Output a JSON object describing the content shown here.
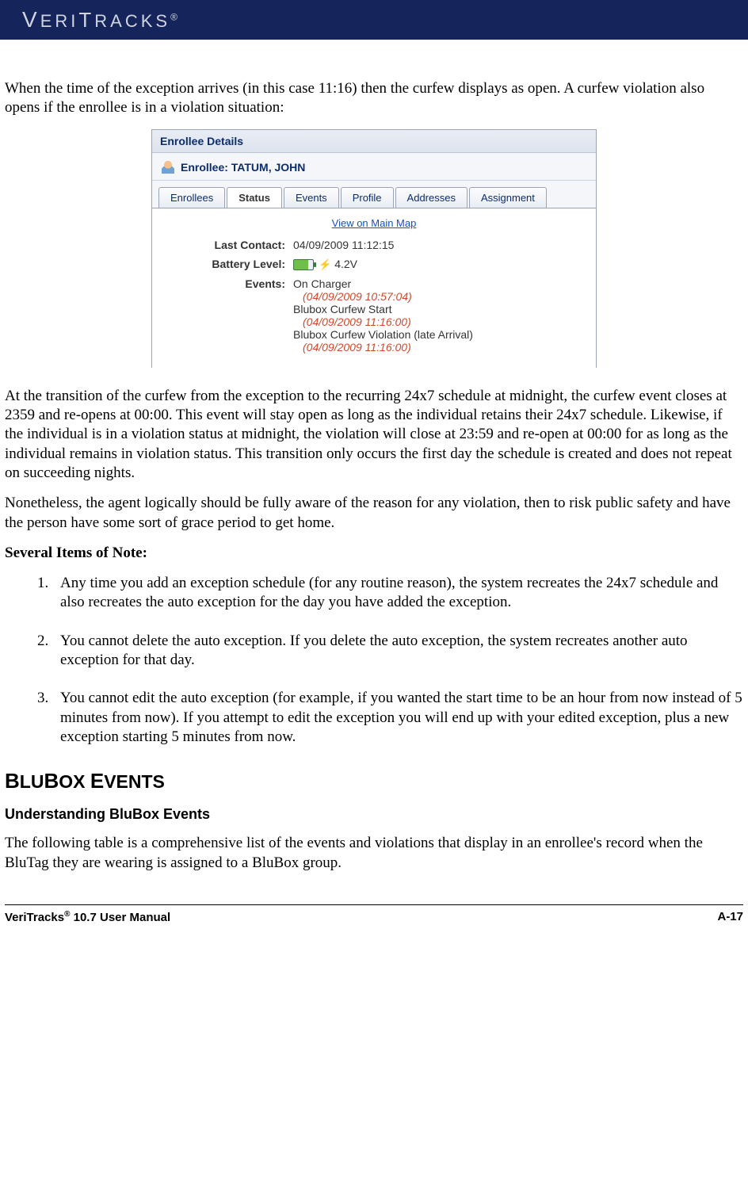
{
  "brand": "VERITRACKS",
  "brand_suffix": "®",
  "paragraphs": {
    "p1": "When the time of the exception arrives (in this case 11:16) then the curfew displays as open.  A curfew violation also opens if the enrollee is in a violation situation:",
    "p2": "At the transition of the curfew from the exception to the recurring 24x7 schedule at midnight, the curfew event closes at 2359 and re-opens at 00:00.  This event will stay open as long as the individual retains their 24x7 schedule.  Likewise, if the individual is in a violation status at midnight, the violation will close at 23:59 and re-open at 00:00 for as long as the individual remains in violation status.  This transition only occurs the first day the schedule is created and does not repeat on succeeding nights.",
    "p3": "Nonetheless, the agent logically should be fully aware of the reason for any violation, then to risk public safety and have the person have some sort of grace period to get home.",
    "notes_heading": "Several Items of Note:",
    "note1": "Any time you add an exception schedule (for any routine reason), the system recreates the 24x7 schedule and also recreates the auto exception for the day you have added the exception.",
    "note2": "You cannot delete the auto exception.  If you delete the auto exception, the system recreates another auto exception for that day.",
    "note3": "You cannot edit the auto exception (for example, if you wanted the start time to be an hour from now instead of 5 minutes from now).  If you attempt to edit the exception you will end up with your edited exception, plus a new exception starting 5 minutes from now.",
    "section_heading_1": "BLUBOX ",
    "section_heading_2": "EVENTS",
    "sub_heading": "Understanding BluBox Events",
    "p4": "The following table is a comprehensive list of the events and violations that display in an enrollee's record when the BluTag they are wearing is assigned to a BluBox group."
  },
  "panel": {
    "title": "Enrollee Details",
    "enrollee_label": "Enrollee: ",
    "enrollee_value": "TATUM, JOHN",
    "tabs": [
      "Enrollees",
      "Status",
      "Events",
      "Profile",
      "Addresses",
      "Assignment"
    ],
    "map_link": "View on Main Map",
    "rows": {
      "last_contact_label": "Last Contact:",
      "last_contact_value": "04/09/2009 11:12:15",
      "battery_label": "Battery Level:",
      "battery_value": "4.2V",
      "events_label": "Events:"
    },
    "events": [
      {
        "name": "On Charger",
        "ts": "(04/09/2009 10:57:04)"
      },
      {
        "name": "Blubox Curfew Start",
        "ts": "(04/09/2009 11:16:00)"
      },
      {
        "name": "Blubox Curfew Violation (late Arrival)",
        "ts": "(04/09/2009 11:16:00)"
      }
    ]
  },
  "footer": {
    "left_1": "VeriTracks",
    "left_sup": "®",
    "left_2": " 10.7 User Manual",
    "right": "A-17"
  }
}
